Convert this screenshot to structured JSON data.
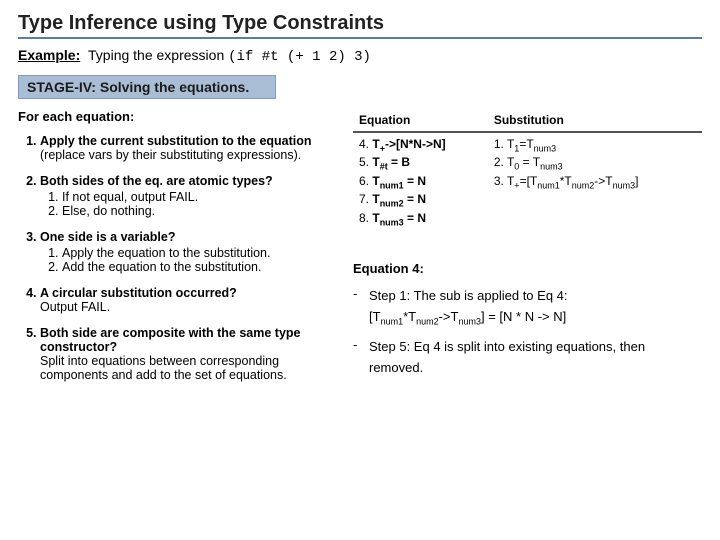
{
  "title": "Type Inference using Type Constraints",
  "example_label": "Example:",
  "example_lead": "Typing the expression",
  "example_code": "(if #t (+ 1 2) 3)",
  "stage_label": "STAGE-IV: Solving the equations.",
  "for_each": "For each equation:",
  "steps": [
    {
      "head": "Apply the current substitution to the equation",
      "tail": "(replace vars by their substituting expressions).",
      "sub": []
    },
    {
      "head": "Both sides of the eq. are atomic types?",
      "tail": "",
      "sub": [
        "If not equal, output FAIL.",
        "Else, do nothing."
      ]
    },
    {
      "head": "One side is a variable?",
      "tail": "",
      "sub": [
        "Apply the equation to the substitution.",
        "Add the equation to the substitution."
      ]
    },
    {
      "head": "A circular substitution occurred?",
      "tail": "Output FAIL.",
      "sub": []
    },
    {
      "head": "Both side are composite with the same type constructor?",
      "tail": "Split into equations between corresponding components and add to the set of equations.",
      "sub": []
    }
  ],
  "table": {
    "headers": [
      "Equation",
      "Substitution"
    ],
    "equation_lines": [
      {
        "n": "4.",
        "lhs": "T",
        "lsub": "+",
        "rhs": "->[N*N->N]"
      },
      {
        "n": "5.",
        "lhs": "T",
        "lsub": "#t",
        "rhs": " = B"
      },
      {
        "n": "6.",
        "lhs": "T",
        "lsub": "num1",
        "rhs": " = N"
      },
      {
        "n": "7.",
        "lhs": "T",
        "lsub": "num2",
        "rhs": " = N"
      },
      {
        "n": "8.",
        "lhs": "T",
        "lsub": "num3",
        "rhs": " = N"
      }
    ],
    "substitution_lines": [
      {
        "n": "1.",
        "txt_html": "T<sub class='sub'>1</sub>=T<sub class='sub'>num3</sub>"
      },
      {
        "n": "2.",
        "txt_html": "T<sub class='sub'>0</sub> = T<sub class='sub'>num3</sub>"
      },
      {
        "n": "3.",
        "txt_html": "T<sub class='sub'>+</sub>=[T<sub class='sub'>num1</sub>*T<sub class='sub'>num2</sub>-&gt;T<sub class='sub'>num3</sub>]"
      }
    ]
  },
  "explain": {
    "header": "Equation 4:",
    "step1_lead": "Step 1: The sub is applied to Eq 4:",
    "step1_eq_html": "[T<sub class='sub'>num1</sub>*T<sub class='sub'>num2</sub>-&gt;T<sub class='sub'>num3</sub>] = [N * N -&gt; N]",
    "step5": "Step 5: Eq 4 is split into existing equations, then removed."
  }
}
